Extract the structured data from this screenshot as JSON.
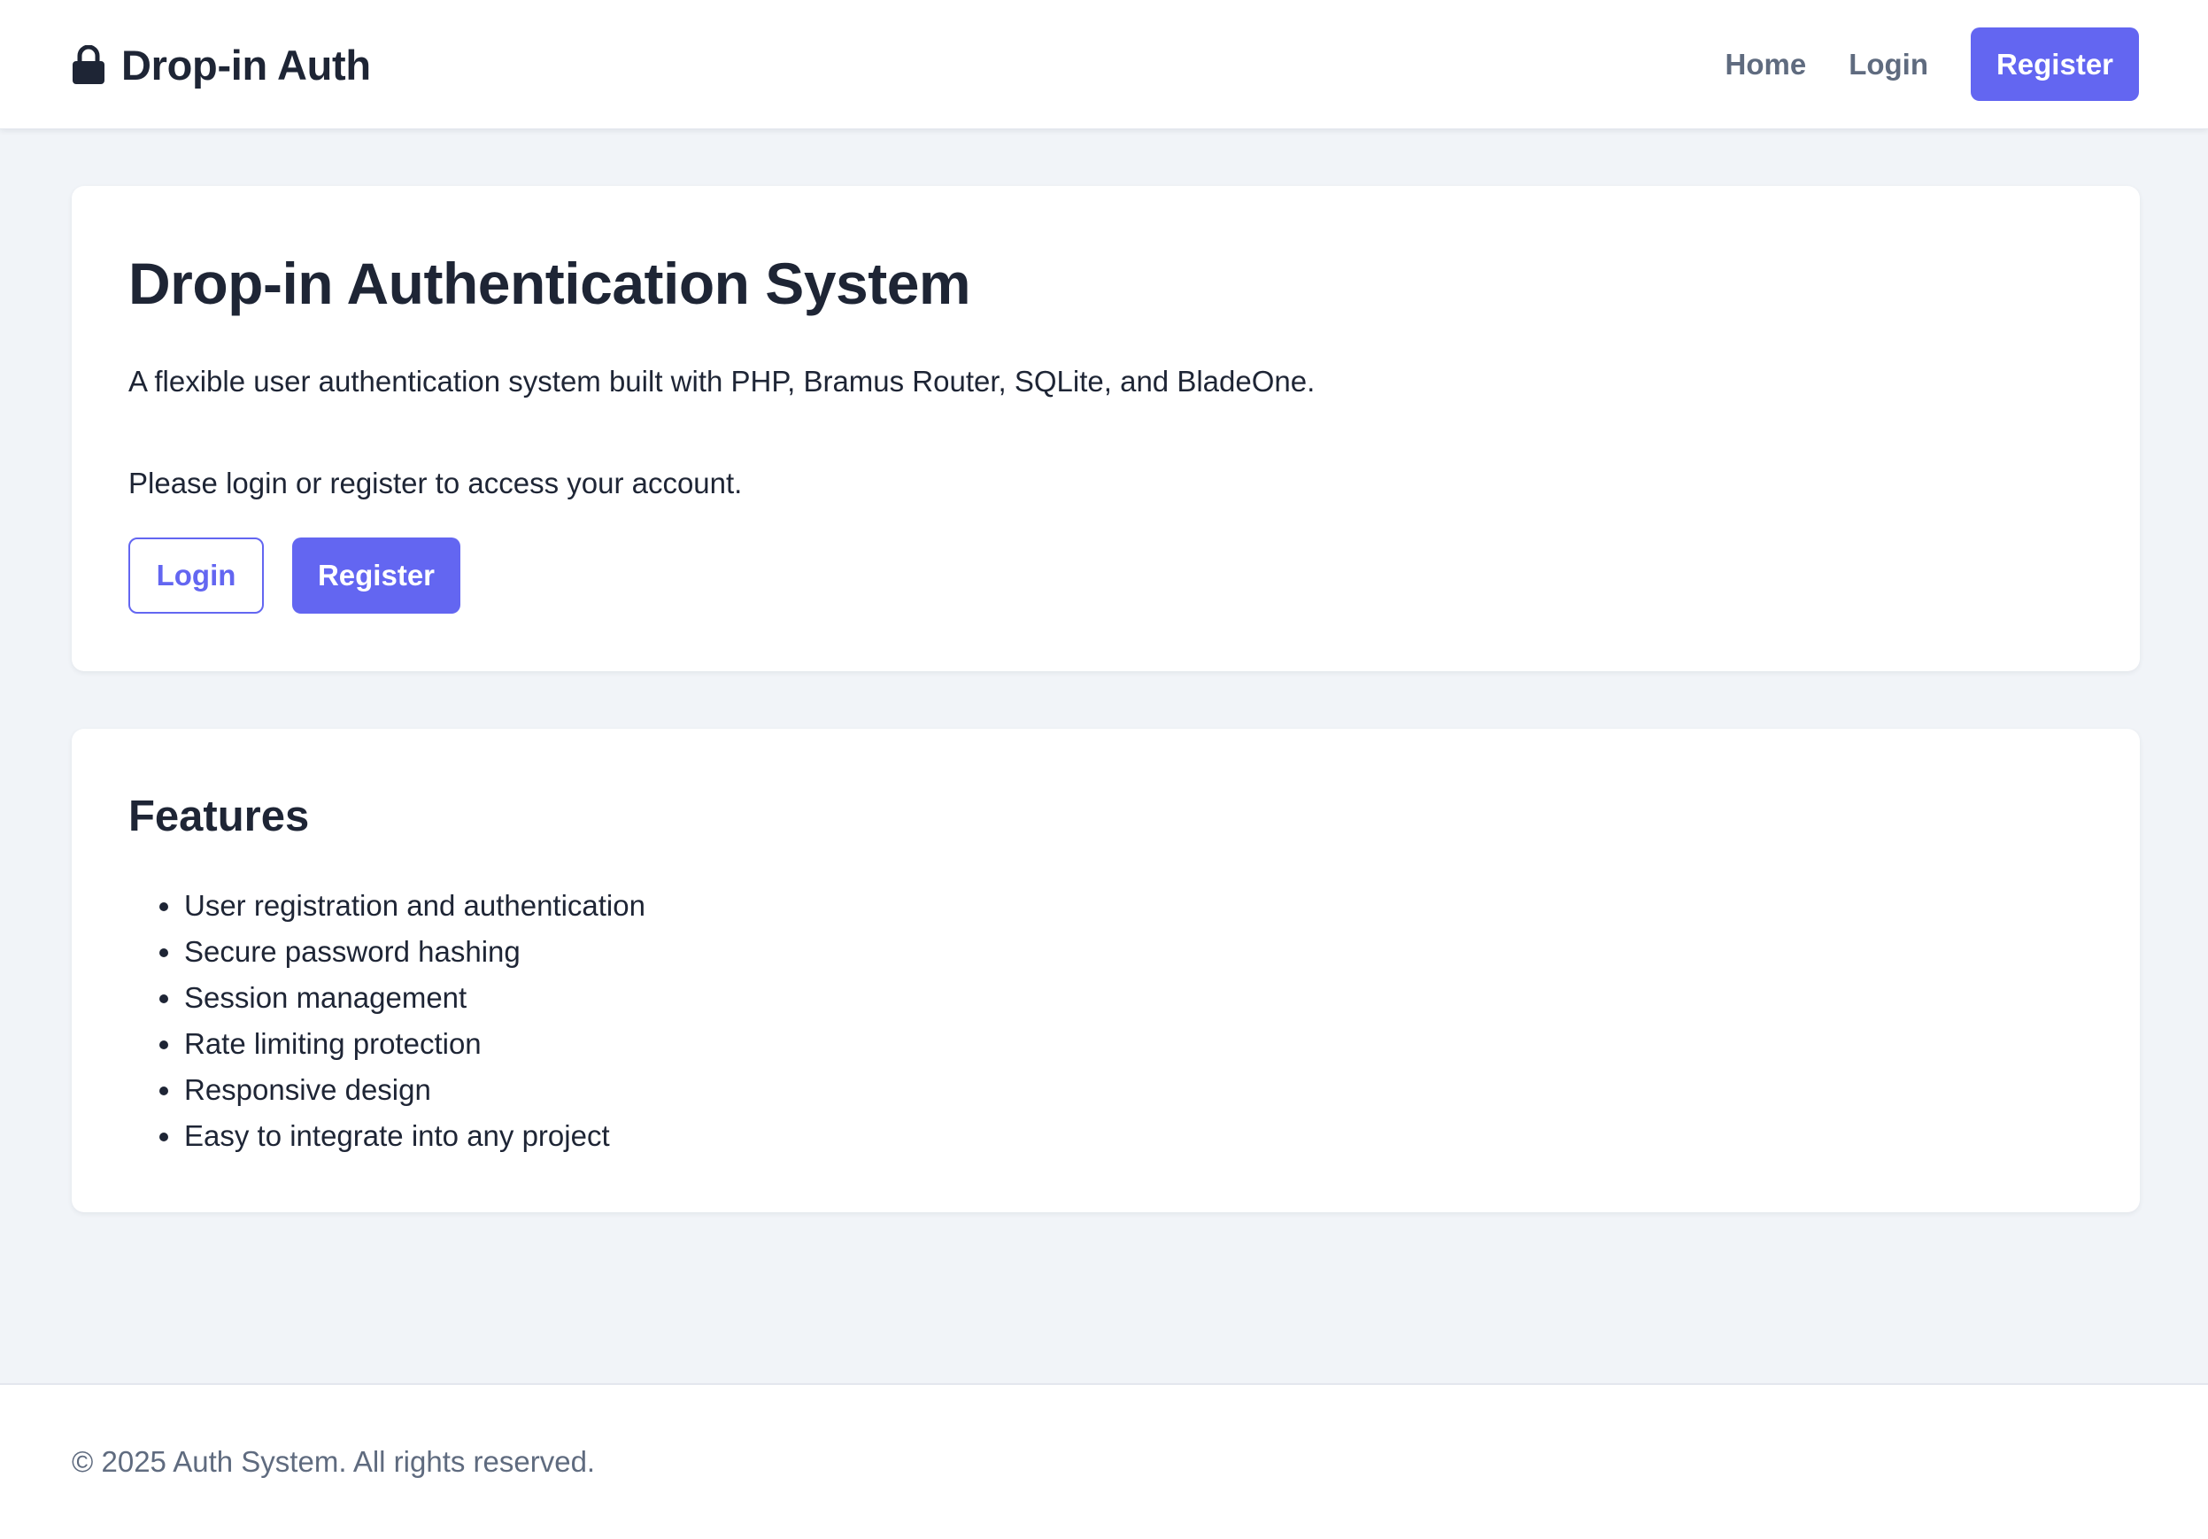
{
  "navbar": {
    "brand": "Drop-in Auth",
    "brand_icon": "lock-icon",
    "links": {
      "home": "Home",
      "login": "Login",
      "register": "Register"
    }
  },
  "hero": {
    "title": "Drop-in Authentication System",
    "description": "A flexible user authentication system built with PHP, Bramus Router, SQLite, and BladeOne.",
    "prompt": "Please login or register to access your account.",
    "login_button": "Login",
    "register_button": "Register"
  },
  "features": {
    "title": "Features",
    "items": [
      "User registration and authentication",
      "Secure password hashing",
      "Session management",
      "Rate limiting protection",
      "Responsive design",
      "Easy to integrate into any project"
    ]
  },
  "footer": {
    "text": "© 2025 Auth System. All rights reserved."
  },
  "colors": {
    "accent": "#6366f1",
    "text": "#1e2535",
    "muted": "#5f6b7f",
    "background": "#f1f4f8"
  }
}
